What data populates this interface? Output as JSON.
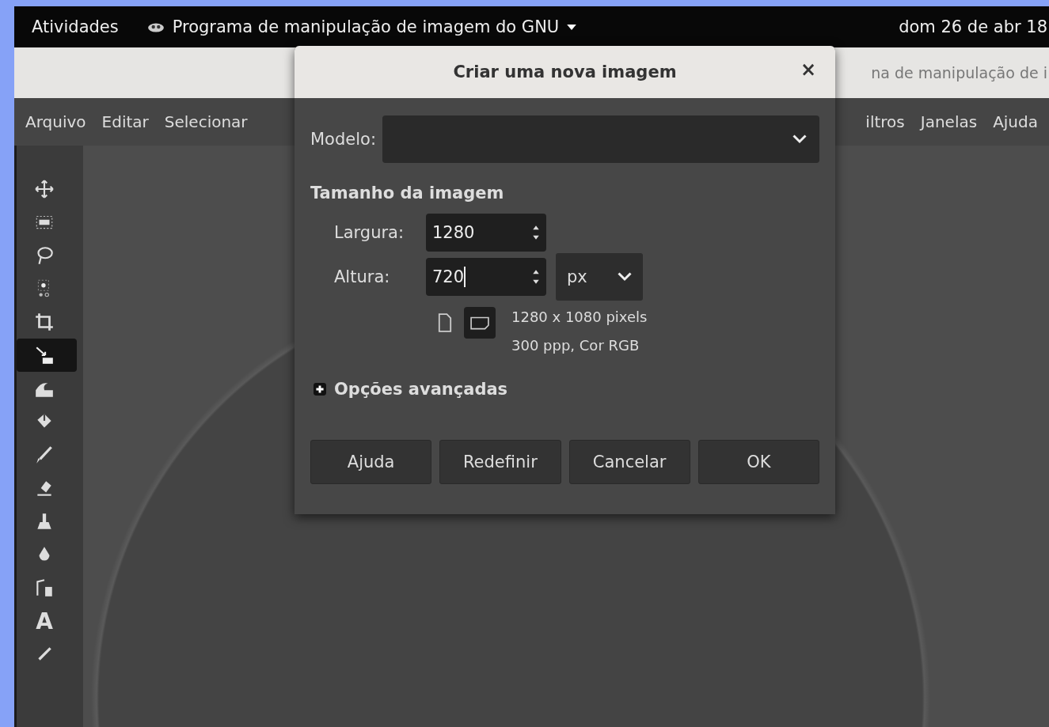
{
  "top_bar": {
    "activities": "Atividades",
    "app_menu": "Programa de manipulação de imagem do GNU",
    "clock": "dom 26 de abr 18"
  },
  "window": {
    "title_fragment": "na de manipulação de i",
    "menu_left": [
      "Arquivo",
      "Editar",
      "Selecionar"
    ],
    "menu_right": [
      "iltros",
      "Janelas",
      "Ajuda"
    ]
  },
  "toolbox": {
    "tools": [
      {
        "kind": "move",
        "selected": false
      },
      {
        "kind": "rect-select",
        "selected": false
      },
      {
        "kind": "lasso",
        "selected": false
      },
      {
        "kind": "fuzzy-select",
        "selected": false
      },
      {
        "kind": "crop",
        "selected": false
      },
      {
        "kind": "warp",
        "selected": true
      },
      {
        "kind": "wave",
        "selected": false
      },
      {
        "kind": "bucket",
        "selected": false
      },
      {
        "kind": "brush",
        "selected": false
      },
      {
        "kind": "eraser",
        "selected": false
      },
      {
        "kind": "stamp",
        "selected": false
      },
      {
        "kind": "drop",
        "selected": false
      },
      {
        "kind": "paths",
        "selected": false
      },
      {
        "kind": "text",
        "label": "A",
        "selected": false
      },
      {
        "kind": "picker",
        "selected": false
      }
    ]
  },
  "dialog": {
    "title": "Criar uma nova imagem",
    "close": "×",
    "template_label": "Modelo:",
    "section": "Tamanho da imagem",
    "width_label": "Largura:",
    "width_value": "1280",
    "height_label": "Altura:",
    "height_value": "720",
    "unit": "px",
    "orientations": [
      {
        "kind": "portrait",
        "selected": false
      },
      {
        "kind": "landscape",
        "selected": true
      }
    ],
    "info_lines": [
      "1280 x 1080 pixels",
      "300 ppp, Cor RGB"
    ],
    "advanced": {
      "label": "Opções avançadas",
      "expanded": false
    },
    "buttons": [
      "Ajuda",
      "Redefinir",
      "Cancelar",
      "OK"
    ]
  }
}
